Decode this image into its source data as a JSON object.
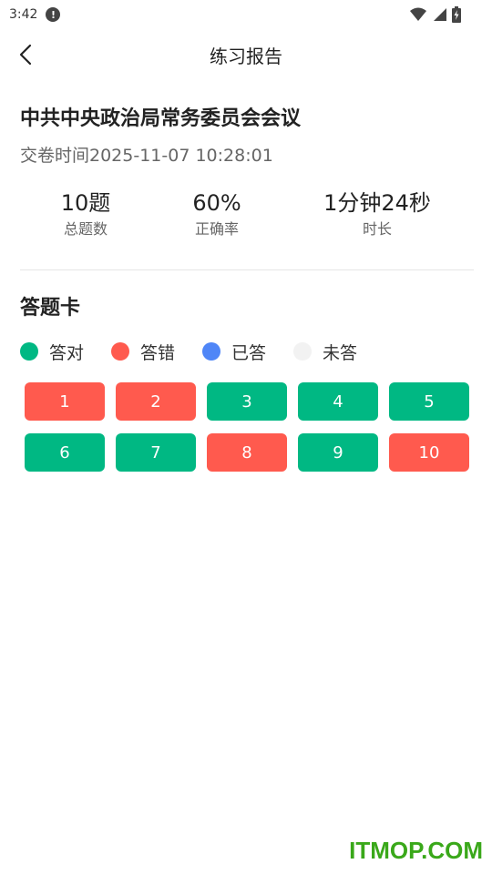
{
  "status_bar": {
    "time": "3:42",
    "alert_glyph": "!"
  },
  "header": {
    "title": "练习报告"
  },
  "exam": {
    "title": "中共中央政治局常务委员会会议",
    "submit_time": "交卷时间2025-11-07 10:28:01"
  },
  "stats": [
    {
      "value": "10题",
      "label": "总题数"
    },
    {
      "value": "60%",
      "label": "正确率"
    },
    {
      "value": "1分钟24秒",
      "label": "时长"
    }
  ],
  "answer_card": {
    "title": "答题卡",
    "legend": [
      {
        "label": "答对",
        "color": "#00b883"
      },
      {
        "label": "答错",
        "color": "#ff5a4e"
      },
      {
        "label": "已答",
        "color": "#4f86f7"
      },
      {
        "label": "未答",
        "color": "#f2f2f2"
      }
    ],
    "questions": [
      {
        "number": "1",
        "status": "wrong"
      },
      {
        "number": "2",
        "status": "wrong"
      },
      {
        "number": "3",
        "status": "correct"
      },
      {
        "number": "4",
        "status": "correct"
      },
      {
        "number": "5",
        "status": "correct"
      },
      {
        "number": "6",
        "status": "correct"
      },
      {
        "number": "7",
        "status": "correct"
      },
      {
        "number": "8",
        "status": "wrong"
      },
      {
        "number": "9",
        "status": "correct"
      },
      {
        "number": "10",
        "status": "wrong"
      }
    ],
    "status_colors": {
      "correct": "#00b883",
      "wrong": "#ff5a4e"
    }
  },
  "watermark": {
    "text": "ITMOP.COM"
  },
  "icons": [
    "alert-icon",
    "wifi-icon",
    "signal-icon",
    "battery-icon",
    "back-arrow-icon"
  ]
}
